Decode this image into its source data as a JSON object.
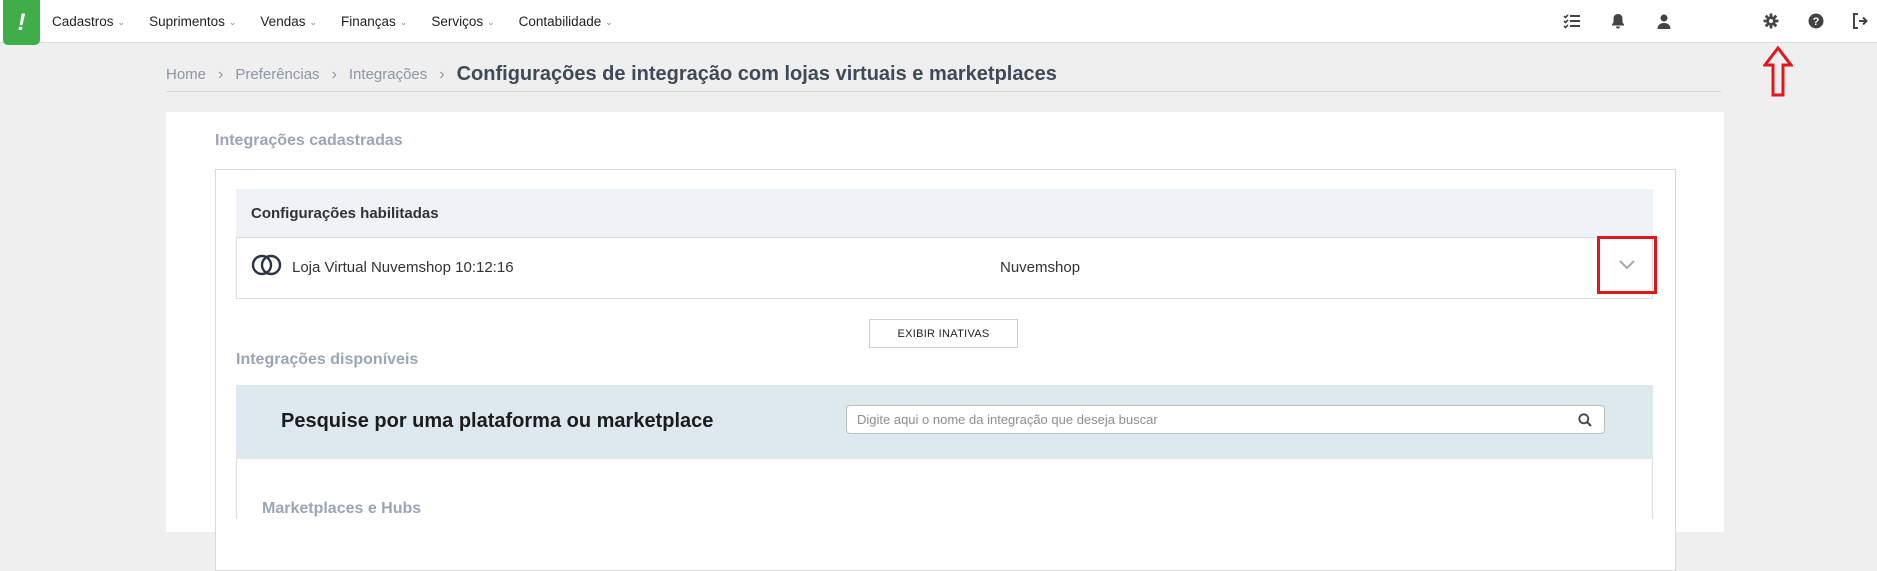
{
  "logo": {
    "glyph": "!",
    "color": "#3fae49"
  },
  "menu": [
    {
      "label": "Cadastros"
    },
    {
      "label": "Suprimentos"
    },
    {
      "label": "Vendas"
    },
    {
      "label": "Finanças"
    },
    {
      "label": "Serviços"
    },
    {
      "label": "Contabilidade"
    }
  ],
  "toolbar_icons": [
    "tasks-icon",
    "bell-icon",
    "user-icon",
    "gear-icon",
    "help-icon",
    "logout-icon"
  ],
  "breadcrumb": {
    "items": [
      "Home",
      "Preferências",
      "Integrações"
    ],
    "current": "Configurações de integração com lojas virtuais e marketplaces"
  },
  "registered": {
    "title": "Integrações cadastradas",
    "enabled_header": "Configurações habilitadas",
    "rows": [
      {
        "name": "Loja Virtual Nuvemshop 10:12:16",
        "platform": "Nuvemshop"
      }
    ],
    "show_inactive_label": "EXIBIR INATIVAS"
  },
  "available": {
    "title": "Integrações disponíveis",
    "search_title": "Pesquise por uma plataforma ou marketplace",
    "search_placeholder": "Digite aqui o nome da integração que deseja buscar",
    "section_marketplaces": "Marketplaces e Hubs"
  },
  "colors": {
    "accent": "#3fae49",
    "highlight": "#e0181e"
  }
}
